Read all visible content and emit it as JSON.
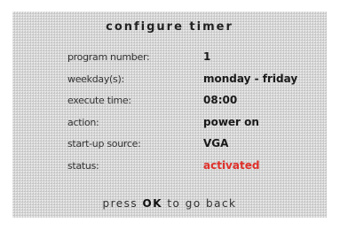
{
  "title": "configure timer",
  "fields": [
    {
      "label": "program number:",
      "value": "1"
    },
    {
      "label": "weekday(s):",
      "value": "monday - friday"
    },
    {
      "label": "execute time:",
      "value": "08:00"
    },
    {
      "label": "action:",
      "value": "power on"
    },
    {
      "label": "start-up source:",
      "value": "VGA"
    },
    {
      "label": "status:",
      "value": "activated"
    }
  ],
  "footer": {
    "before": "press",
    "key": "OK",
    "after": "to go back"
  },
  "colors": {
    "panel_background": "#d6d6d6",
    "status_value": "#e0302a"
  }
}
